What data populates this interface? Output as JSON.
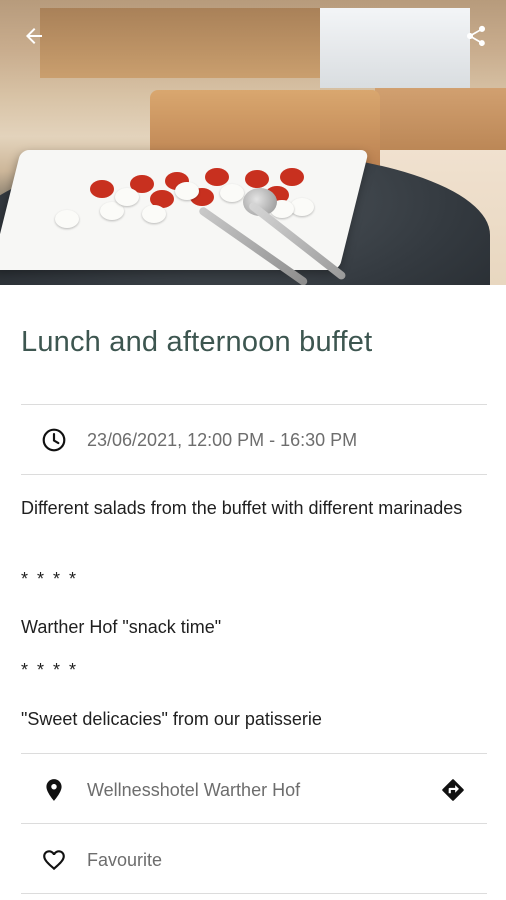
{
  "event": {
    "title": "Lunch and afternoon buffet",
    "datetime": "23/06/2021, 12:00 PM - 16:30 PM",
    "description": [
      "Different salads from the buffet with different marinades",
      "* * * *",
      "Warther Hof \"snack time\"",
      "* * * *",
      "\"Sweet delicacies\" from our patisserie"
    ],
    "location": "Wellnesshotel Warther Hof",
    "favourite_label": "Favourite"
  },
  "icons": {
    "back": "arrow-left-icon",
    "share": "share-icon",
    "clock": "clock-icon",
    "location": "location-pin-icon",
    "directions": "directions-icon",
    "heart": "heart-outline-icon"
  },
  "colors": {
    "title": "#3d5650",
    "muted_text": "#6d6d6d",
    "divider": "#dcdcdc"
  }
}
